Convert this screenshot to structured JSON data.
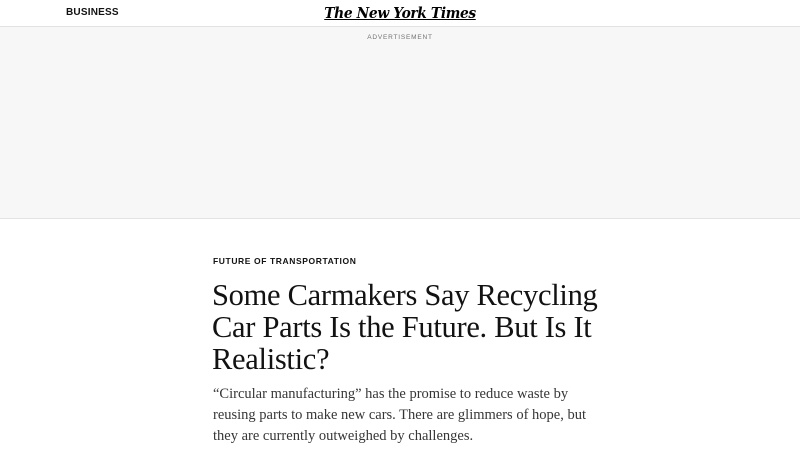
{
  "masthead": {
    "section": "BUSINESS",
    "logo_text": "The New York Times"
  },
  "ad": {
    "label": "ADVERTISEMENT"
  },
  "article": {
    "kicker": "FUTURE OF TRANSPORTATION",
    "headline": "Some Carmakers Say Recycling Car Parts Is the Future. But Is It Realistic?",
    "summary": "“Circular manufacturing” has the promise to reduce waste by reusing parts to make new cars. There are glimmers of hope, but they are currently outweighed by challenges."
  },
  "colors": {
    "text": "#121212",
    "summary_text": "#363636",
    "ad_background": "#f7f7f7",
    "divider": "#e2e2e2"
  }
}
